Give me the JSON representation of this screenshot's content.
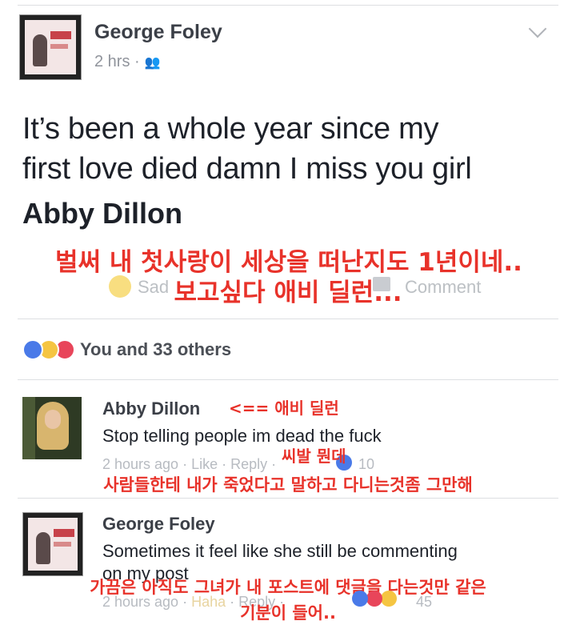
{
  "post": {
    "author": "George Foley",
    "time": "2 hrs ·",
    "audience_icon": "friends-icon",
    "line1": "It’s been a whole year since my",
    "line2": "first love died damn I miss you girl",
    "tagged": "Abby Dillon",
    "translation_line1": "벌써 내 첫사랑이 세상을 떠난지도 1년이네..",
    "translation_line2": "보고싶다 애비 딜런...",
    "reaction_label": "Sad",
    "comment_label": "Comment"
  },
  "reactions": {
    "summary": "You and 33 others",
    "icons": [
      "like-icon",
      "sad-icon",
      "love-icon"
    ]
  },
  "comments": [
    {
      "name": "Abby Dillon",
      "note": "<== 애비 딜런",
      "text": "Stop telling people im dead the fuck",
      "meta": "2 hours ago · Like · Reply ·",
      "like_count": "10",
      "translation_line1": "씨발 뭔데",
      "translation_line2": "사람들한테 내가 죽었다고 말하고 다니는것좀 그만해"
    },
    {
      "name": "George Foley",
      "text_line1": "Sometimes it feel like she still be commenting",
      "text_line2": "on my post",
      "meta": "2 hours ago · ",
      "reaction_word": "Haha",
      "meta_tail": " · Reply ·",
      "reaction_count": "45",
      "translation_line1": "가끔은 아직도 그녀가 내 포스트에 댓글을 다는것만 같은",
      "translation_line2": "기분이 들어.."
    }
  ],
  "colors": {
    "overlay_red": "#e8322a",
    "like_blue": "#4a7ae8",
    "love_red": "#e8455a",
    "sad_yellow": "#f5c542"
  }
}
